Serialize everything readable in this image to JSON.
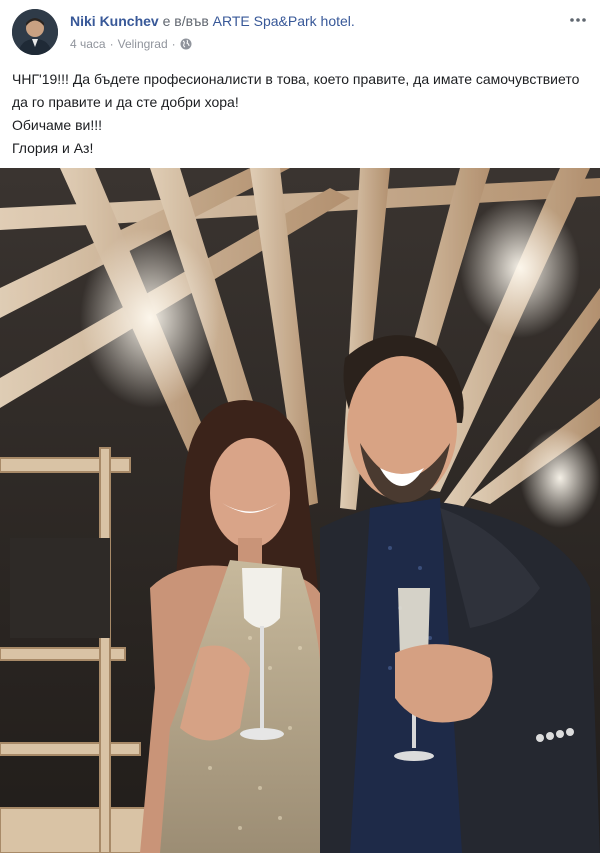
{
  "post": {
    "author_name": "Niki Kunchev",
    "relation_text": " е в/във ",
    "place_name": "ARTE Spa&Park hotel.",
    "timestamp": "4 часа",
    "separator": "·",
    "location": "Velingrad",
    "privacy_icon": "globe-icon",
    "more_icon": "more-horizontal-icon",
    "text_lines": [
      "ЧНГ'19!!! Да бъдете професионалисти в това, което правите, да имате самочувствието да го правите и да сте добри хора!",
      "Обичаме ви!!!",
      "Глория и Аз!"
    ]
  },
  "colors": {
    "link": "#385898",
    "meta": "#90949c",
    "text": "#1c1e21"
  }
}
